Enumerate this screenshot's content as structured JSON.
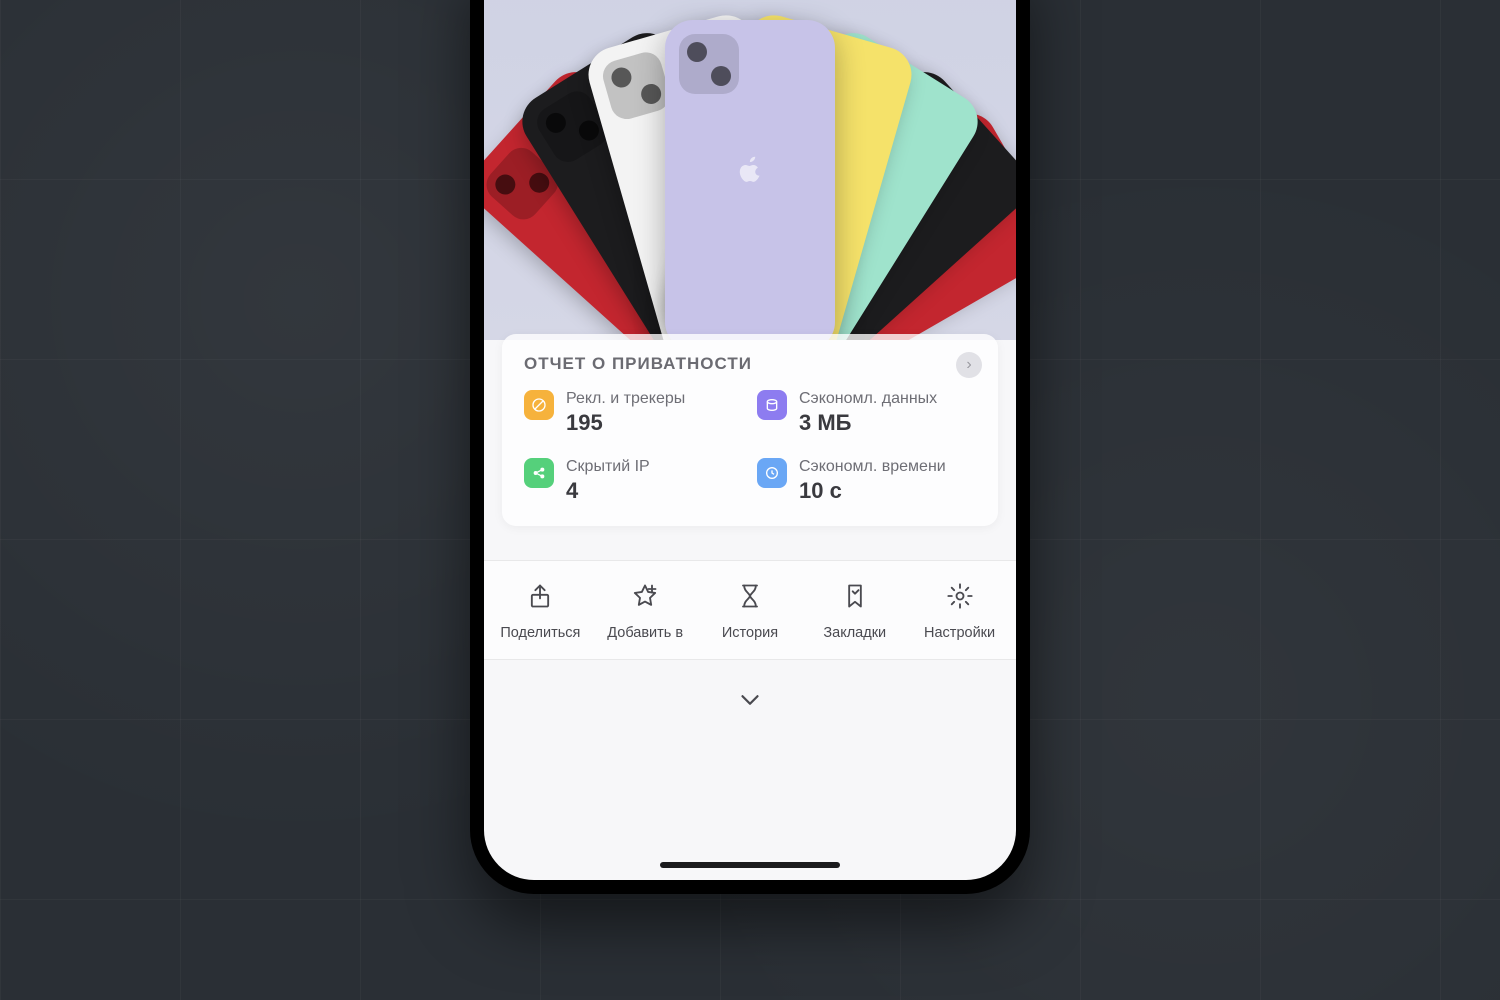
{
  "report": {
    "title": "ОТЧЕТ О ПРИВАТНОСТИ",
    "stats": {
      "ads": {
        "label": "Рекл. и трекеры",
        "value": "195"
      },
      "data": {
        "label": "Сэкономл. данных",
        "value": "3 МБ"
      },
      "ip": {
        "label": "Скрытий IP",
        "value": "4"
      },
      "time": {
        "label": "Сэкономл. времени",
        "value": "10 с"
      }
    }
  },
  "toolbar": {
    "share": "Поделиться",
    "add": "Добавить в",
    "history": "История",
    "bookmarks": "Закладки",
    "settings": "Настройки"
  }
}
